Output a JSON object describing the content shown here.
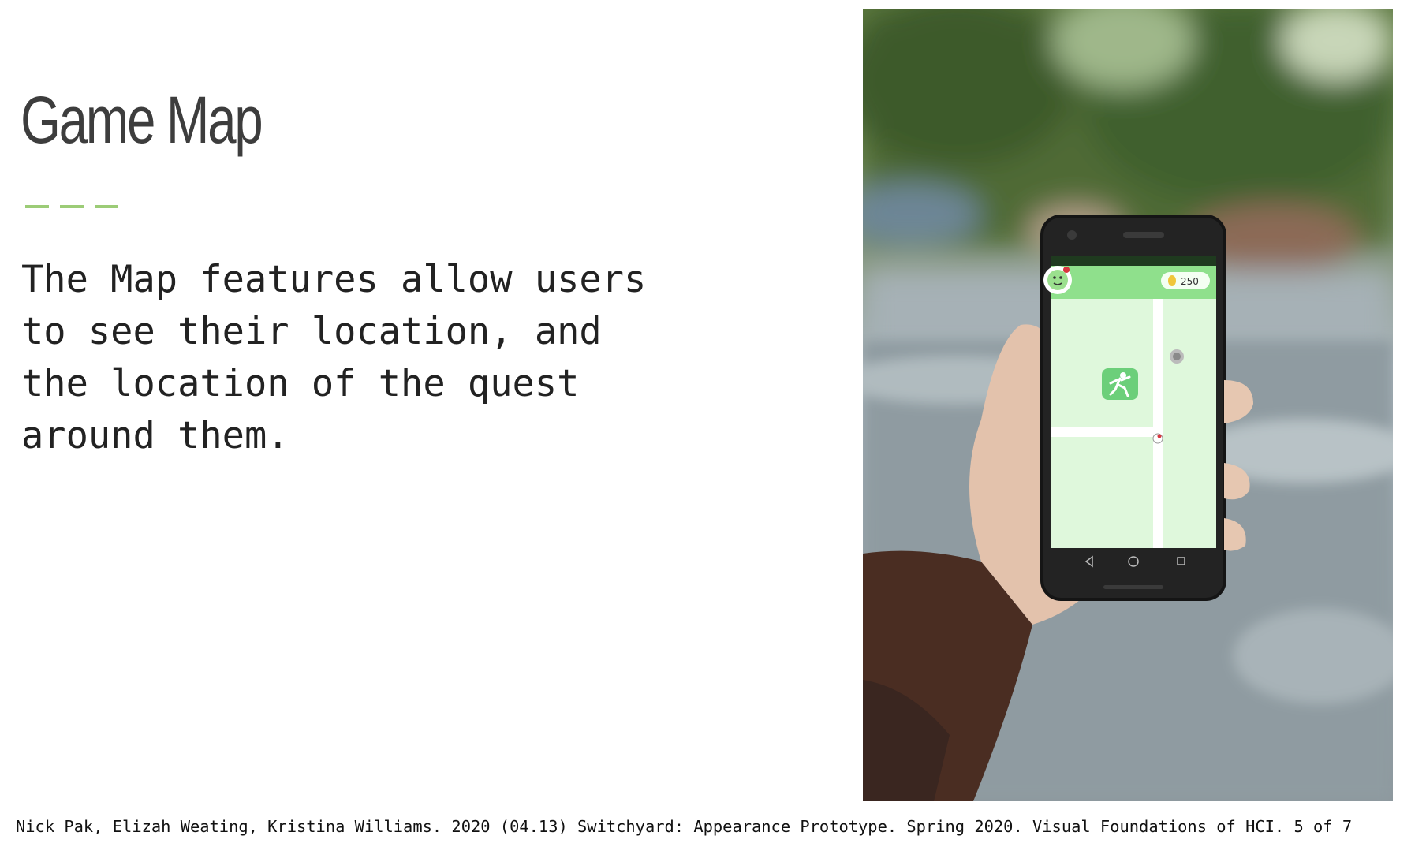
{
  "slide": {
    "title": "Game Map",
    "body": "The Map features allow users\nto see their location, and\nthe location of the quest\naround them.",
    "citation": "Nick Pak, Elizah Weating, Kristina Williams. 2020 (04.13) Switchyard: Appearance Prototype. Spring 2020. Visual Foundations of HCI. 5 of 7"
  },
  "phone_screen": {
    "coin_count": "250"
  },
  "colors": {
    "accent": "#9ccc77",
    "title": "#3d3d3d",
    "map_green": "#dff8dc",
    "map_header": "#8fe08c"
  },
  "icons": [
    "avatar-icon",
    "coin-icon",
    "runner-icon",
    "quest-marker-icon",
    "back-icon",
    "home-icon",
    "recents-icon"
  ]
}
